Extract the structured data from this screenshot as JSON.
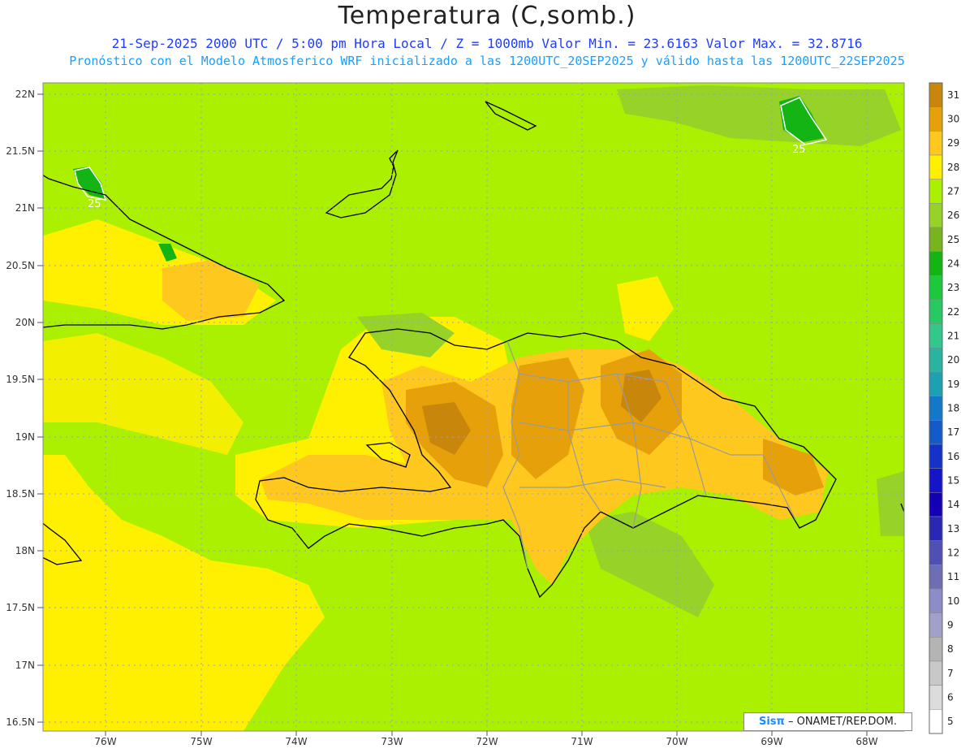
{
  "header": {
    "title": "Temperatura (C,somb.)",
    "line2": "21-Sep-2025 2000 UTC / 5:00 pm Hora Local / Z = 1000mb   Valor Min. = 23.6163  Valor Max. = 32.8716",
    "line3": "Pronóstico con el Modelo Atmosferico WRF inicializado a las 1200UTC_20SEP2025 y válido hasta las  1200UTC_22SEP2025"
  },
  "axes": {
    "lat_labels": [
      "22N",
      "21.5N",
      "21N",
      "20.5N",
      "20N",
      "19.5N",
      "19N",
      "18.5N",
      "18N",
      "17.5N",
      "17N",
      "16.5N"
    ],
    "lon_labels": [
      "76W",
      "75W",
      "74W",
      "73W",
      "72W",
      "71W",
      "70W",
      "69W",
      "68W"
    ]
  },
  "colorbar": {
    "labels": [
      "31",
      "30",
      "29",
      "28",
      "27",
      "26",
      "25",
      "24",
      "23",
      "22",
      "21",
      "20",
      "19",
      "18",
      "17",
      "16",
      "15",
      "14",
      "13",
      "12",
      "11",
      "10",
      "9",
      "8",
      "7",
      "6",
      "5"
    ],
    "colors": [
      "#c8860a",
      "#e6a00a",
      "#ffc81e",
      "#fff000",
      "#aaf000",
      "#96d228",
      "#78b41e",
      "#14b414",
      "#1ec83c",
      "#28c864",
      "#32c88c",
      "#28b4a0",
      "#1ea0b4",
      "#1478c8",
      "#145ac8",
      "#1432c8",
      "#1414c8",
      "#1400b4",
      "#2828b4",
      "#5050b4",
      "#6e6eb4",
      "#8c8cc8",
      "#a0a0c8",
      "#b4b4b4",
      "#c8c8c8",
      "#dcdcdc",
      "#ffffff"
    ]
  },
  "contour_labels": [
    "25",
    "25"
  ],
  "credit": {
    "logo": "Sisπ",
    "text": "– ONAMET/REP.DOM."
  }
}
